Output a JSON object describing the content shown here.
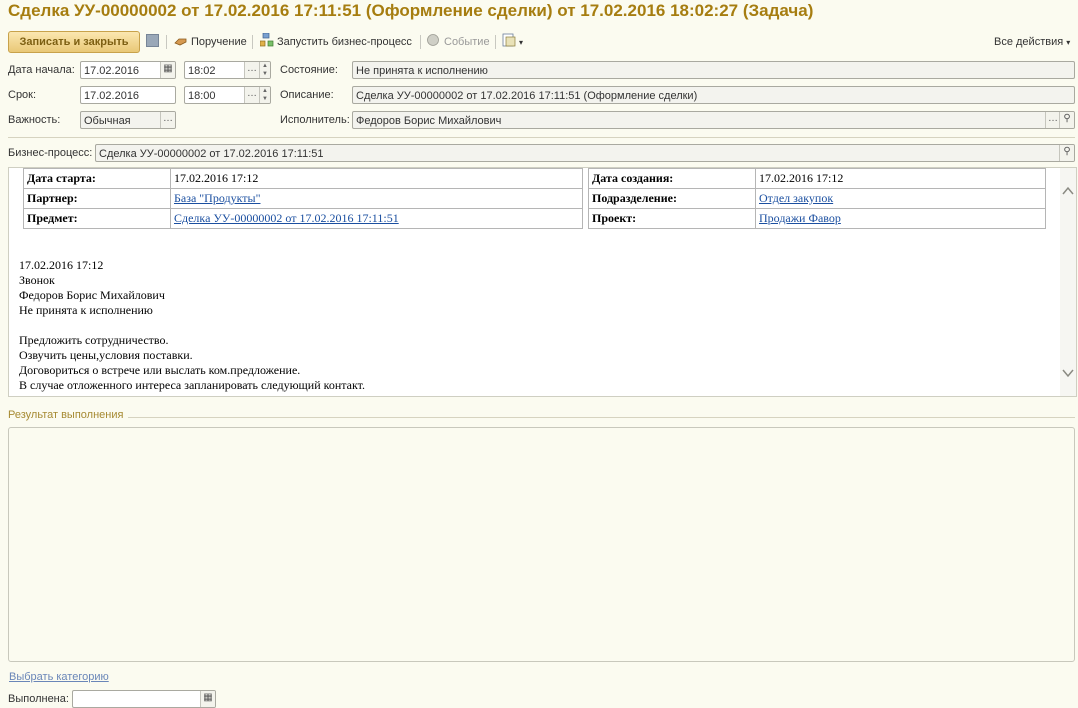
{
  "window": {
    "title": "Сделка УУ-00000002 от 17.02.2016 17:11:51 (Оформление сделки) от 17.02.2016 18:02:27 (Задача)"
  },
  "toolbar": {
    "save_close": "Записать и закрыть",
    "assignment": "Поручение",
    "start_process": "Запустить бизнес-процесс",
    "event": "Событие",
    "all_actions": "Все действия"
  },
  "form": {
    "start_date_label": "Дата начала:",
    "start_date": "17.02.2016",
    "start_time": "18:02",
    "state_label": "Состояние:",
    "state": "Не принята к исполнению",
    "due_label": "Срок:",
    "due_date": "17.02.2016",
    "due_time": "18:00",
    "description_label": "Описание:",
    "description": "Сделка УУ-00000002 от 17.02.2016 17:11:51 (Оформление сделки)",
    "importance_label": "Важность:",
    "importance": "Обычная",
    "executor_label": "Исполнитель:",
    "executor": "Федоров Борис Михайлович",
    "bp_label": "Бизнес-процесс:",
    "bp": "Сделка УУ-00000002 от 17.02.2016 17:11:51"
  },
  "details": {
    "left": [
      {
        "key": "Дата старта:",
        "value": "17.02.2016 17:12",
        "link": false
      },
      {
        "key": "Партнер:",
        "value": "База \"Продукты\"",
        "link": true
      },
      {
        "key": "Предмет:",
        "value": "Сделка УУ-00000002 от 17.02.2016 17:11:51",
        "link": true
      }
    ],
    "right": [
      {
        "key": "Дата создания:",
        "value": "17.02.2016 17:12",
        "link": false
      },
      {
        "key": "Подразделение:",
        "value": "Отдел закупок",
        "link": true
      },
      {
        "key": "Проект:",
        "value": "Продажи Фавор",
        "link": true
      }
    ],
    "text_lines": [
      "17.02.2016 17:12",
      "Звонок",
      "Федоров Борис Михайлович",
      "Не принята к исполнению",
      "",
      "Предложить сотрудничество.",
      "Озвучить цены,условия поставки.",
      "Договориться о встрече или выслать ком.предложение.",
      "В случае отложенного интереса запланировать следующий контакт."
    ]
  },
  "result": {
    "title": "Результат выполнения",
    "value": ""
  },
  "bottom": {
    "choose_category": "Выбрать категорию",
    "done_label": "Выполнена:"
  },
  "colors": {
    "title": "#a67d10",
    "accent_button": "#e9c877",
    "link": "#1b4fa0"
  }
}
